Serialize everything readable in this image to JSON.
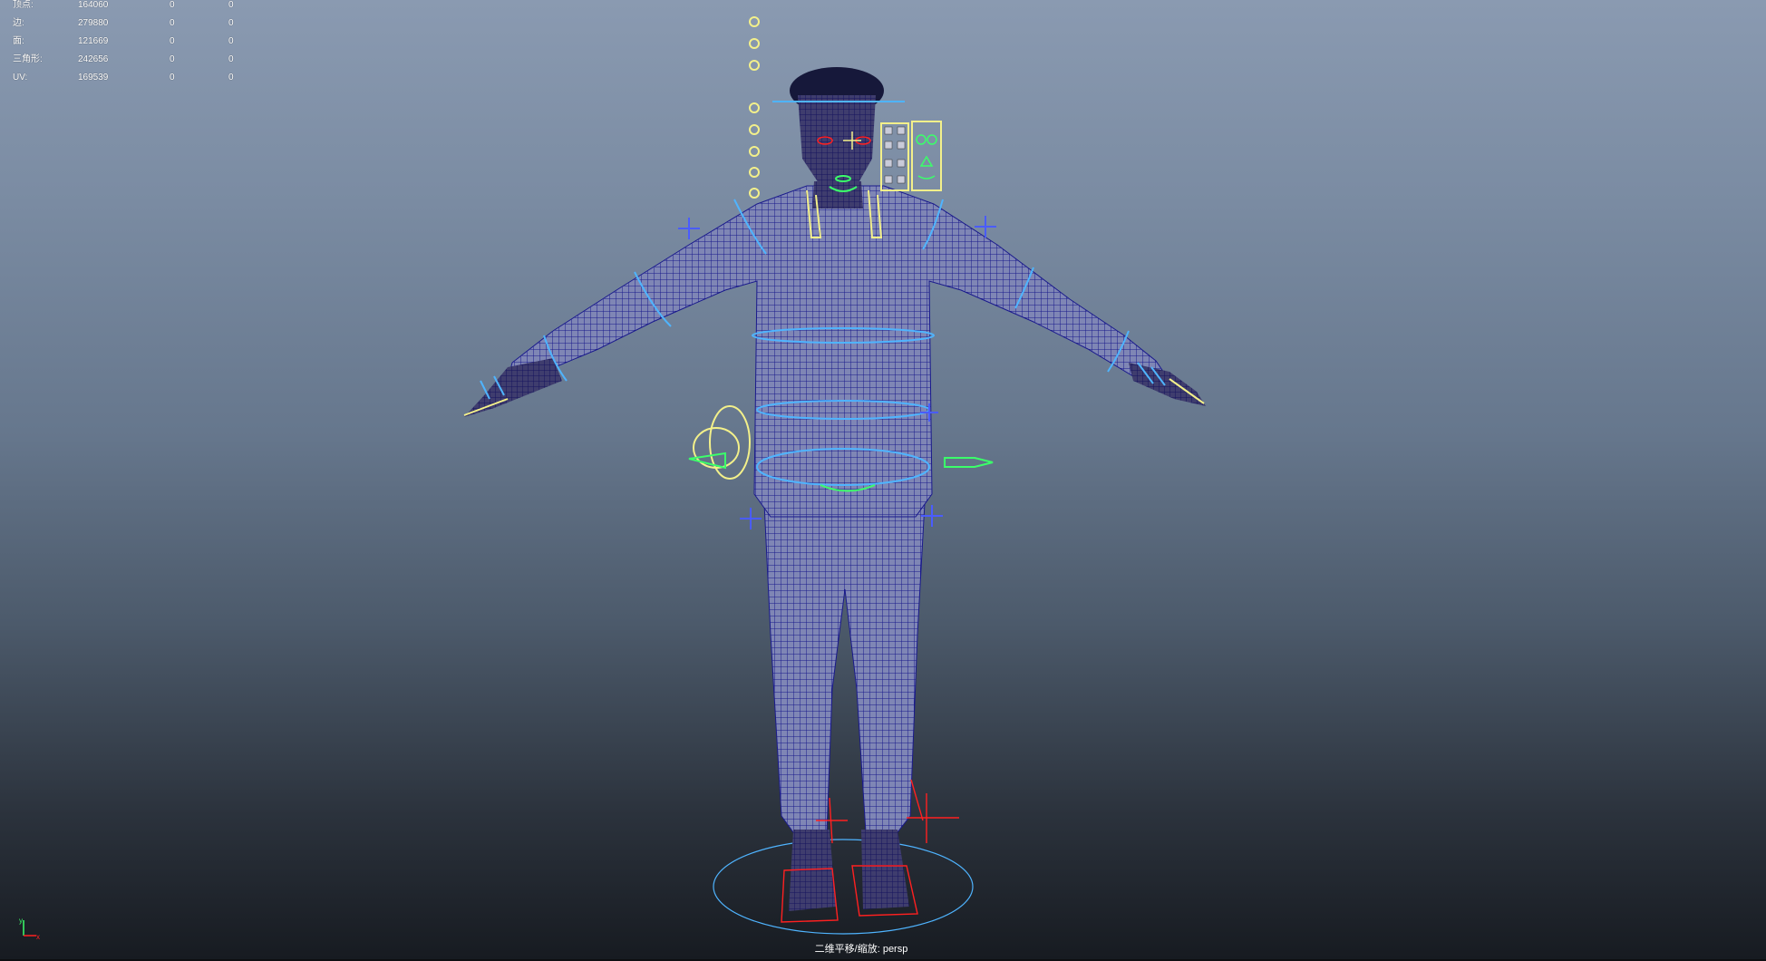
{
  "viewport": {
    "camera_label": "二维平移/缩放: persp"
  },
  "hud": {
    "rows": [
      {
        "label": "顶点:",
        "values": [
          "164060",
          "0",
          "0"
        ]
      },
      {
        "label": "边:",
        "values": [
          "279880",
          "0",
          "0"
        ]
      },
      {
        "label": "面:",
        "values": [
          "121669",
          "0",
          "0"
        ]
      },
      {
        "label": "三角形:",
        "values": [
          "242656",
          "0",
          "0"
        ]
      },
      {
        "label": "UV:",
        "values": [
          "169539",
          "0",
          "0"
        ]
      }
    ]
  },
  "axis": {
    "y_label": "y",
    "x_label": "x"
  },
  "colors": {
    "wireframe": "#1a1a8c",
    "control_blue": "#4fb4ff",
    "control_yellow": "#f3f08a",
    "control_green": "#3bff6a",
    "control_red": "#ff2020",
    "locator_blue": "#4a5cff"
  },
  "icons": [
    "character-rig",
    "axis-gizmo"
  ]
}
